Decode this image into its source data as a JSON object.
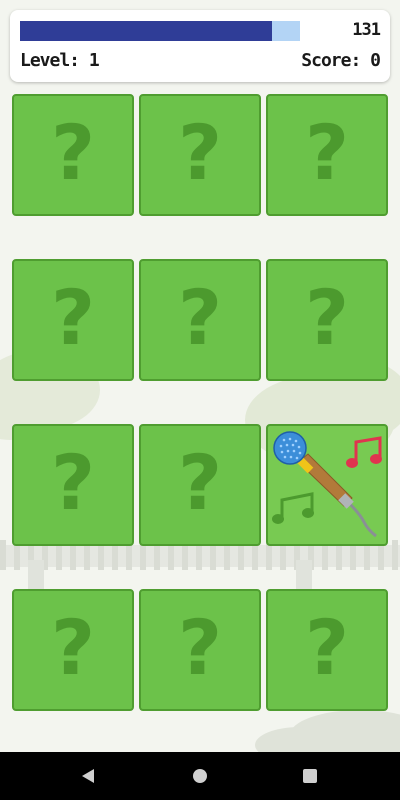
{
  "hud": {
    "timer_value": "131",
    "timer_fraction": 0.9,
    "level_label": "Level: 1",
    "score_label": "Score: 0"
  },
  "cards": [
    {
      "state": "hidden",
      "symbol": "?"
    },
    {
      "state": "hidden",
      "symbol": "?"
    },
    {
      "state": "hidden",
      "symbol": "?"
    },
    {
      "state": "hidden",
      "symbol": "?"
    },
    {
      "state": "hidden",
      "symbol": "?"
    },
    {
      "state": "hidden",
      "symbol": "?"
    },
    {
      "state": "hidden",
      "symbol": "?"
    },
    {
      "state": "hidden",
      "symbol": "?"
    },
    {
      "state": "revealed",
      "icon": "microphone-music-icon"
    },
    {
      "state": "hidden",
      "symbol": "?"
    },
    {
      "state": "hidden",
      "symbol": "?"
    },
    {
      "state": "hidden",
      "symbol": "?"
    }
  ],
  "colors": {
    "card_green": "#6cc24a",
    "card_border": "#4f9d30",
    "question_mark": "#4c9a2e",
    "timer_fill": "#2f3d97",
    "timer_track": "#b3d4f5"
  },
  "navbar": {
    "back_icon": "back-triangle-icon",
    "home_icon": "home-circle-icon",
    "recent_icon": "recent-square-icon"
  }
}
